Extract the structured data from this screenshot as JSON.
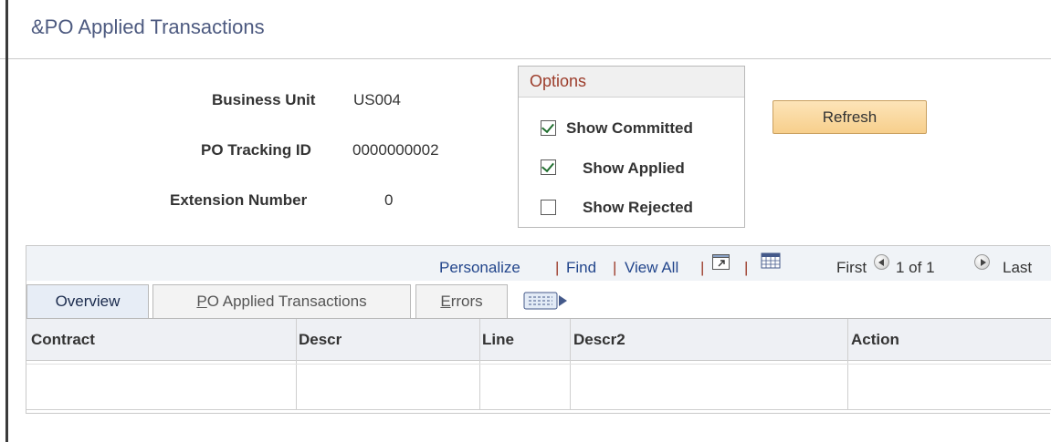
{
  "title": "&PO Applied Transactions",
  "header": {
    "business_unit_label": "Business Unit",
    "business_unit_value": "US004",
    "tracking_id_label": "PO Tracking ID",
    "tracking_id_value": "0000000002",
    "extension_label": "Extension Number",
    "extension_value": "0"
  },
  "options": {
    "title": "Options",
    "show_committed": {
      "label": "Show Committed",
      "checked": true
    },
    "show_applied": {
      "label": "Show Applied",
      "checked": true
    },
    "show_rejected": {
      "label": "Show Rejected",
      "checked": false
    }
  },
  "refresh_label": "Refresh",
  "grid": {
    "personalize": "Personalize",
    "find": "Find",
    "view_all": "View All",
    "sep": "|",
    "first": "First",
    "pager": "1 of 1",
    "last": "Last",
    "tabs": [
      {
        "label": "Overview",
        "active": true
      },
      {
        "label": "PO Applied Transactions",
        "active": false
      },
      {
        "label": "Errors",
        "active": false
      }
    ],
    "columns": [
      "Contract",
      "Descr",
      "Line",
      "Descr2",
      "Action"
    ]
  },
  "colors": {
    "title": "#4d5a80",
    "link": "#23468c",
    "options_title": "#9c3c2a",
    "refresh_bg": "#f7cf8c",
    "check": "#1f6e2e"
  },
  "icons": [
    "new-window-icon",
    "download-grid-icon",
    "previous-icon",
    "next-icon",
    "show-all-columns-icon"
  ]
}
